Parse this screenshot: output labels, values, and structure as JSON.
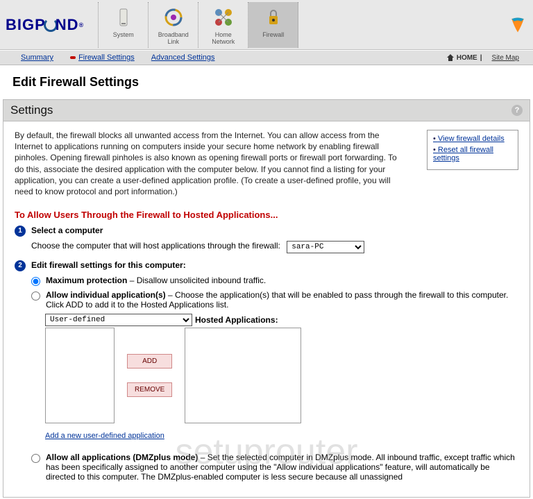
{
  "brand": "BIGP ND",
  "nav": {
    "system": "System",
    "broadband": "Broadband\nLink",
    "homenet": "Home\nNetwork",
    "firewall": "Firewall"
  },
  "subnav": {
    "summary": "Summary",
    "firewall_settings": "Firewall Settings",
    "advanced": "Advanced Settings",
    "home": "HOME",
    "sitemap": "Site Map"
  },
  "page_title": "Edit Firewall Settings",
  "panel_title": "Settings",
  "intro_text": "By default, the firewall blocks all unwanted access from the Internet. You can allow access from the Internet to applications running on computers inside your secure home network by enabling firewall pinholes. Opening firewall pinholes is also known as opening firewall ports or firewall port forwarding. To do this, associate the desired application with the computer below. If you cannot find a listing for your application, you can create a user-defined application profile. (To create a user-defined profile, you will need to know protocol and port information.)",
  "sidebar": {
    "view": "View firewall details",
    "reset": "Reset all firewall settings"
  },
  "red_heading": "To Allow Users Through the Firewall to Hosted Applications...",
  "step1": {
    "title": "Select a computer",
    "desc": "Choose the computer that will host applications through the firewall:",
    "selected": "sara-PC"
  },
  "step2": {
    "title": "Edit firewall settings for this computer:"
  },
  "options": {
    "max_label": "Maximum protection",
    "max_desc": " – Disallow unsolicited inbound traffic.",
    "indiv_label": "Allow individual application(s)",
    "indiv_desc": " – Choose the application(s) that will be enabled to pass through the firewall to this computer. Click ADD to add it to the Hosted Applications list.",
    "dmz_label": "Allow all applications (DMZplus mode)",
    "dmz_desc": " –  Set the selected computer in DMZplus mode. All inbound traffic, except traffic which has been specifically assigned to another computer using the \"Allow individual applications\" feature, will automatically be directed to this computer. The DMZplus-enabled computer is less secure because all unassigned"
  },
  "app_select": "User-defined",
  "hosted_label": "Hosted Applications:",
  "btn_add": "ADD",
  "btn_remove": "REMOVE",
  "add_link": "Add a new user-defined application",
  "watermark": "setuprouter"
}
